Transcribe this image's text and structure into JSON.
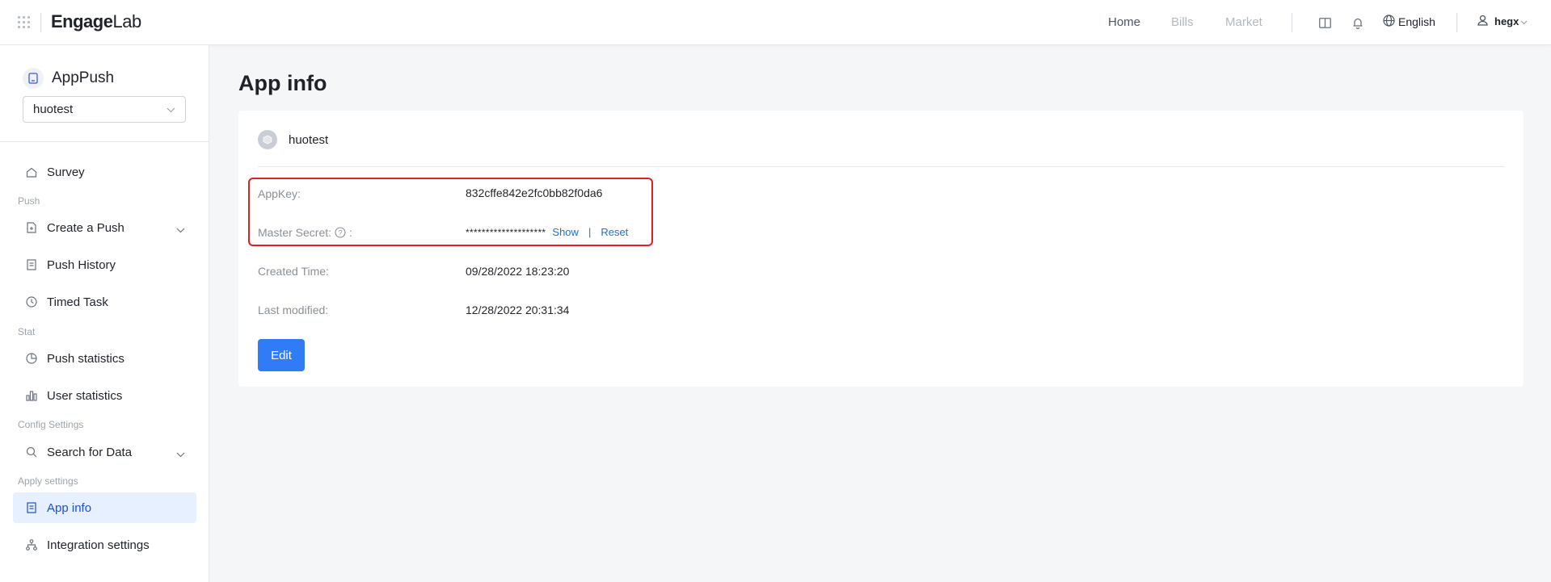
{
  "header": {
    "logo_brand": "Engage",
    "logo_suffix": "Lab",
    "nav": {
      "home": "Home",
      "bills": "Bills",
      "market": "Market"
    },
    "language": "English",
    "username": "hegx"
  },
  "sidebar": {
    "product": "AppPush",
    "app_select": "huotest",
    "items": {
      "survey": "Survey",
      "group_push": "Push",
      "create_push": "Create a Push",
      "push_history": "Push History",
      "timed_task": "Timed Task",
      "group_stat": "Stat",
      "push_statistics": "Push statistics",
      "user_statistics": "User statistics",
      "group_config": "Config Settings",
      "search_data": "Search for Data",
      "group_apply": "Apply settings",
      "app_info": "App info",
      "integration": "Integration settings"
    }
  },
  "main": {
    "title": "App info",
    "app_name": "huotest",
    "fields": {
      "appkey_label": "AppKey:",
      "appkey_value": "832cffe842e2fc0bb82f0da6",
      "secret_label": "Master Secret:",
      "secret_colon": ":",
      "secret_value": "********************",
      "show_link": "Show",
      "separator": "|",
      "reset_link": "Reset",
      "created_label": "Created Time:",
      "created_value": "09/28/2022 18:23:20",
      "modified_label": "Last modified:",
      "modified_value": "12/28/2022 20:31:34"
    },
    "edit_button": "Edit"
  },
  "colors": {
    "accent": "#2f7cf6",
    "highlight": "#e02020",
    "active_bg": "#e6f0ff"
  }
}
